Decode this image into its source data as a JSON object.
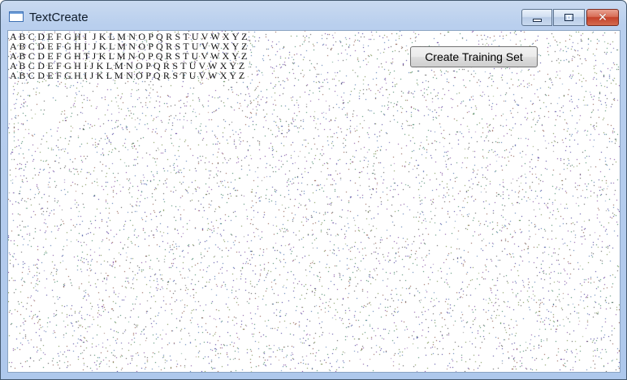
{
  "window": {
    "title": "TextCreate",
    "controls": {
      "minimize": "minimize-icon",
      "maximize": "maximize-icon",
      "close": "close-icon",
      "close_glyph": "✕"
    }
  },
  "client": {
    "text_lines": [
      "A B C D E F G H I  J K L M N O P Q R S T U V W X Y Z",
      "A B C D E F G H I  J K L M N O P Q R S T U V W X Y Z",
      "A B C D E F G H T J K L M N O P Q R S T U V W X Y Z",
      "A B C D E F G H I J K L M N O P Q R S T U V W X Y Z",
      "A B C D E F G H I J K L M N O P Q R S T U V W X Y Z"
    ],
    "create_button_label": "Create Training Set",
    "noise_colors": [
      "#2a1f8a",
      "#6a2b8e",
      "#1c6b4a",
      "#3a3a3a",
      "#5c7a2a",
      "#7a3b2a",
      "#2f5fa0"
    ]
  }
}
